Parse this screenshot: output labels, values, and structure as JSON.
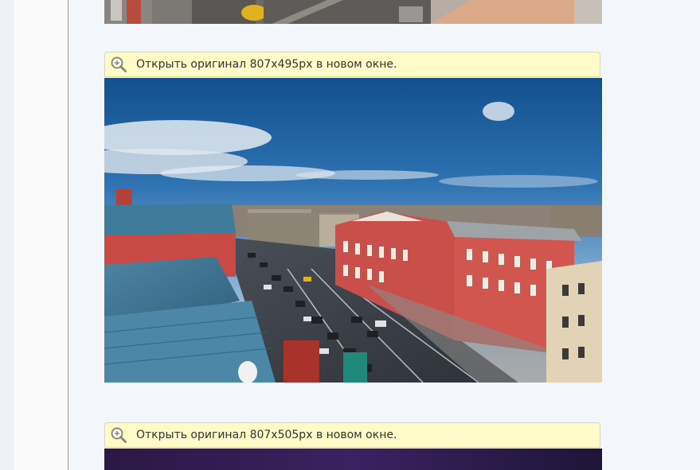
{
  "images": [
    {
      "notice": {
        "prefix": "Открыть оригинал",
        "size": "807x495px",
        "suffix": "в новом окне."
      }
    },
    {
      "notice": {
        "prefix": "Открыть оригинал",
        "size": "807x505px",
        "suffix": "в новом окне."
      }
    }
  ],
  "icons": {
    "notice_icon": "zoom-in-magnifier-icon"
  },
  "colors": {
    "notice_bg": "#fffbc8",
    "notice_border": "#e6d98a",
    "page_bg": "#f3f6fa",
    "column_border": "#7f9fbf"
  }
}
